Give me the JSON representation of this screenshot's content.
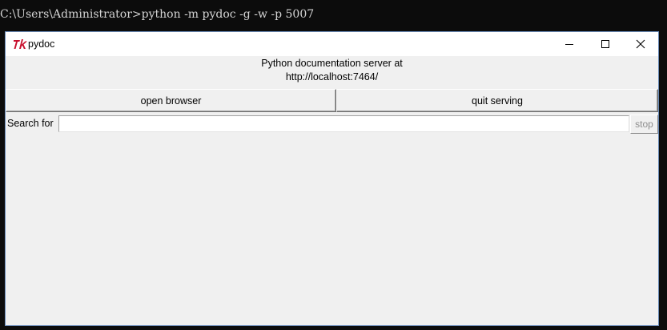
{
  "console": {
    "command_line": "C:\\Users\\Administrator>python -m pydoc -g -w -p 5007"
  },
  "window": {
    "title": "pydoc",
    "icon": "tk-feather-icon",
    "controls": [
      "minimize-icon",
      "maximize-icon",
      "close-icon"
    ]
  },
  "server": {
    "message_line1": "Python documentation server at",
    "message_line2": "http://localhost:7464/"
  },
  "buttons": {
    "open_browser": "open browser",
    "quit_serving": "quit serving"
  },
  "search": {
    "label": "Search for",
    "value": "",
    "stop_label": "stop"
  },
  "colors": {
    "console_bg": "#0c0c0c",
    "window_bg": "#f0f0f0",
    "titlebar_bg": "#ffffff",
    "tk_logo_red": "#c8102e"
  }
}
